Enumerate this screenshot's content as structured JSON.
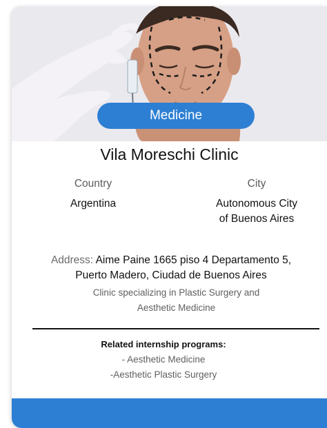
{
  "card": {
    "image_alt": "Man with eyes closed and dashed surgical markings on face, gloved hands holding a syringe",
    "category": "Medicine",
    "name": "Vila Moreschi Clinic",
    "country_label": "Country",
    "country_value": "Argentina",
    "city_label": "City",
    "city_value_line1": "Autonomous City",
    "city_value_line2": "of Buenos Aires",
    "address_label": "Address:",
    "address_line1": "Aime Paine 1665 piso 4 Departamento 5,",
    "address_line2": "Puerto Madero, Ciudad de Buenos Aires",
    "description_line1": "Clinic specializing in Plastic Surgery and",
    "description_line2": "Aesthetic Medicine",
    "related_title": "Related internship programs:",
    "related_programs": [
      "- Aesthetic Medicine",
      "-Aesthetic Plastic Surgery"
    ]
  },
  "colors": {
    "accent": "#2d7fd3",
    "text": "#111111",
    "muted": "#5f5f5f"
  }
}
